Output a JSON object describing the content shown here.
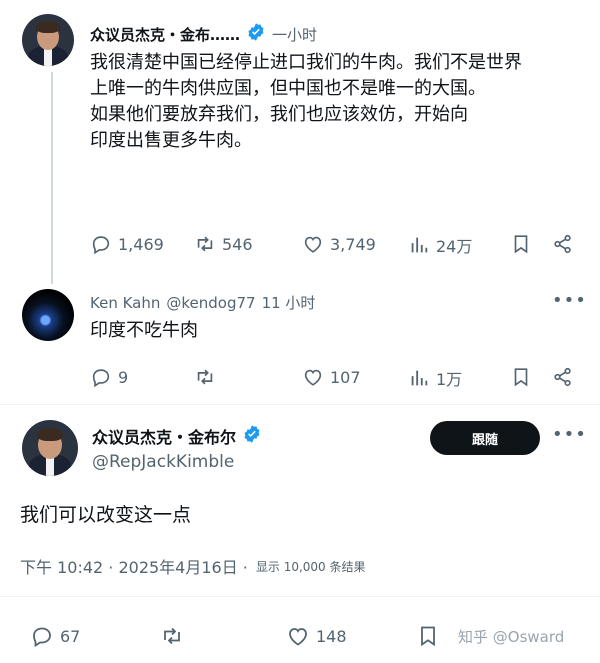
{
  "tweet1": {
    "author": "众议员杰克・金布……",
    "time": "一小时",
    "text_lines": [
      "我很清楚中国已经停止进口我们的牛肉。我们不是世界",
      "上唯一的牛肉供应国，但中国也不是唯一的大国。",
      "如果他们要放弃我们，我们也应该效仿，开始向",
      "印度出售更多牛肉。"
    ],
    "replies": "1,469",
    "reposts": "546",
    "likes": "3,749",
    "views": "24万"
  },
  "tweet2": {
    "author": "Ken Kahn",
    "handle": "@kendog77",
    "time": "11 小时",
    "text": "印度不吃牛肉",
    "replies": "9",
    "reposts": "",
    "likes": "107",
    "views": "1万"
  },
  "tweet3": {
    "author": "众议员杰克・金布尔",
    "handle": "@RepJackKimble",
    "follow_label": "跟随",
    "text": "我们可以改变这一点",
    "timestamp": "下午 10:42 · 2025年4月16日 ·",
    "views_info": "显示 10,000 条结果",
    "replies": "67",
    "likes": "148"
  },
  "watermark": "知乎 @Osward",
  "colors": {
    "verified": "#1d9bf0",
    "text": "#0f1419",
    "muted": "#536471",
    "button": "#0f1419"
  }
}
